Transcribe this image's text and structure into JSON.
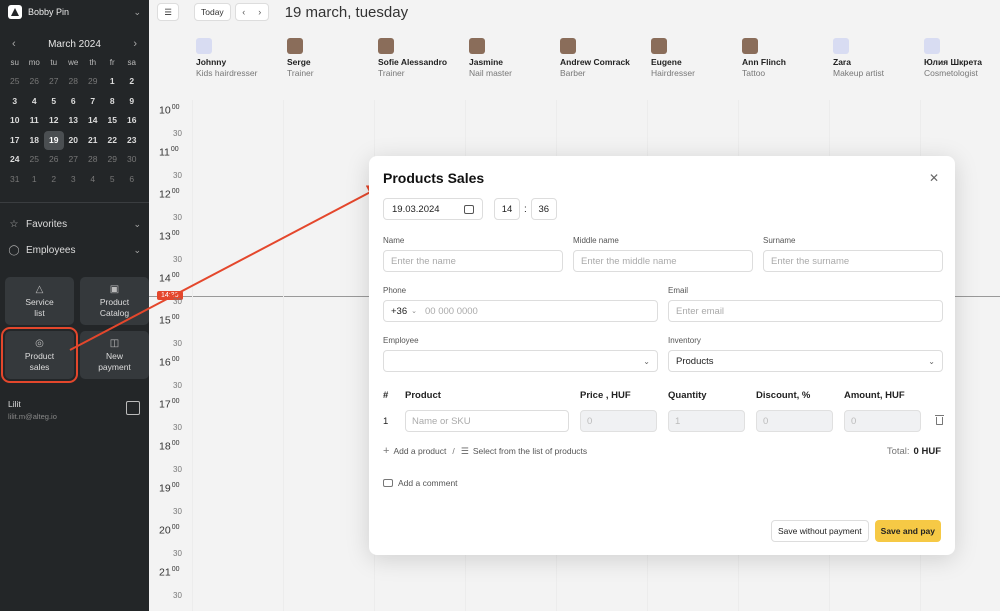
{
  "sidebar": {
    "brand": "Bobby Pin",
    "month": "March 2024",
    "weekdays": [
      "su",
      "mo",
      "tu",
      "we",
      "th",
      "fr",
      "sa"
    ],
    "days": [
      {
        "d": "25",
        "m": true
      },
      {
        "d": "26",
        "m": true
      },
      {
        "d": "27",
        "m": true
      },
      {
        "d": "28",
        "m": true
      },
      {
        "d": "29",
        "m": true
      },
      {
        "d": "1",
        "m": false
      },
      {
        "d": "2",
        "m": false
      },
      {
        "d": "3",
        "m": false
      },
      {
        "d": "4",
        "m": false
      },
      {
        "d": "5",
        "m": false
      },
      {
        "d": "6",
        "m": false
      },
      {
        "d": "7",
        "m": false
      },
      {
        "d": "8",
        "m": false
      },
      {
        "d": "9",
        "m": false
      },
      {
        "d": "10",
        "m": false
      },
      {
        "d": "11",
        "m": false
      },
      {
        "d": "12",
        "m": false
      },
      {
        "d": "13",
        "m": false
      },
      {
        "d": "14",
        "m": false
      },
      {
        "d": "15",
        "m": false
      },
      {
        "d": "16",
        "m": false
      },
      {
        "d": "17",
        "m": false
      },
      {
        "d": "18",
        "m": false
      },
      {
        "d": "19",
        "m": false,
        "today": true
      },
      {
        "d": "20",
        "m": false
      },
      {
        "d": "21",
        "m": false
      },
      {
        "d": "22",
        "m": false
      },
      {
        "d": "23",
        "m": false
      },
      {
        "d": "24",
        "m": false
      },
      {
        "d": "25",
        "m": true
      },
      {
        "d": "26",
        "m": true
      },
      {
        "d": "27",
        "m": true
      },
      {
        "d": "28",
        "m": true
      },
      {
        "d": "29",
        "m": true
      },
      {
        "d": "30",
        "m": true
      },
      {
        "d": "31",
        "m": true
      },
      {
        "d": "1",
        "m": true
      },
      {
        "d": "2",
        "m": true
      },
      {
        "d": "3",
        "m": true
      },
      {
        "d": "4",
        "m": true
      },
      {
        "d": "5",
        "m": true
      },
      {
        "d": "6",
        "m": true
      }
    ],
    "favorites": "Favorites",
    "employees": "Employees",
    "tiles": [
      {
        "line1": "Service",
        "line2": "list",
        "icon": "service-list-icon"
      },
      {
        "line1": "Product",
        "line2": "Catalog",
        "icon": "product-catalog-icon"
      },
      {
        "line1": "Product",
        "line2": "sales",
        "icon": "product-sales-icon",
        "selected": true
      },
      {
        "line1": "New",
        "line2": "payment",
        "icon": "new-payment-icon"
      }
    ],
    "user_name": "Lilit",
    "user_email": "lilit.m@alteg.io"
  },
  "topbar": {
    "today": "Today",
    "date_title": "19 march, tuesday"
  },
  "staff": [
    {
      "name": "Johnny",
      "role": "Kids hairdresser",
      "photo": false
    },
    {
      "name": "Serge",
      "role": "Trainer",
      "photo": true
    },
    {
      "name": "Sofie Alessandro",
      "role": "Trainer",
      "photo": true
    },
    {
      "name": "Jasmine",
      "role": "Nail master",
      "photo": true
    },
    {
      "name": "Andrew Comrack",
      "role": "Barber",
      "photo": true
    },
    {
      "name": "Eugene",
      "role": "Hairdresser",
      "photo": true
    },
    {
      "name": "Ann Flinch",
      "role": "Tattoo",
      "photo": true
    },
    {
      "name": "Zara",
      "role": "Makeup artist",
      "photo": false
    },
    {
      "name": "Юлия Шкрета",
      "role": "Cosmetologist",
      "photo": false
    }
  ],
  "timeline": {
    "hours": [
      "10",
      "11",
      "12",
      "13",
      "14",
      "15",
      "16",
      "17",
      "18",
      "19",
      "20",
      "21"
    ],
    "minute_label": "30",
    "hour_suffix": "00",
    "now": "14:36"
  },
  "modal": {
    "title": "Products Sales",
    "date": "19.03.2024",
    "hour": "14",
    "minute": "36",
    "name_label": "Name",
    "name_placeholder": "Enter the name",
    "middle_label": "Middle name",
    "middle_placeholder": "Enter the middle name",
    "surname_label": "Surname",
    "surname_placeholder": "Enter the surname",
    "phone_label": "Phone",
    "phone_code": "+36",
    "phone_placeholder": "00 000 0000",
    "email_label": "Email",
    "email_placeholder": "Enter email",
    "employee_label": "Employee",
    "employee_value": "",
    "inventory_label": "Inventory",
    "inventory_value": "Products",
    "columns": [
      "#",
      "Product",
      "Price , HUF",
      "Quantity",
      "Discount, %",
      "Amount, HUF"
    ],
    "rows": [
      {
        "num": "1",
        "product_placeholder": "Name or SKU",
        "price": "0",
        "qty": "1",
        "discount": "0",
        "amount": "0"
      }
    ],
    "add_product": "Add a product",
    "select_list": "Select from the list of products",
    "total_label": "Total:",
    "total_value": "0 HUF",
    "add_comment": "Add a comment",
    "save_without": "Save without payment",
    "save_pay": "Save and pay"
  },
  "colors": {
    "accent": "#f6c945",
    "annotation": "#e4472c",
    "sidebar_bg": "#232628"
  }
}
